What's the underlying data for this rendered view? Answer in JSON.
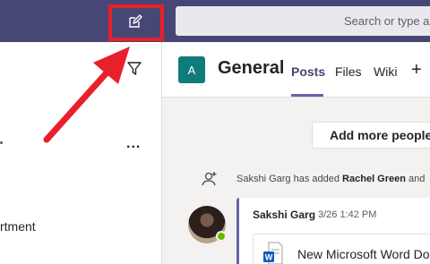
{
  "topbar": {
    "compose_icon": "compose-pencil-icon",
    "search_placeholder": "Search or type a"
  },
  "left_pane": {
    "filter_icon": "filter-icon",
    "more_options": "...",
    "dept_text": "rtment"
  },
  "channel": {
    "avatar_letter": "A",
    "name": "General",
    "tabs": [
      "Posts",
      "Files",
      "Wiki"
    ],
    "add_tab": "+"
  },
  "feed": {
    "add_people_label": "Add more people",
    "system_message": {
      "actor": "Sakshi Garg",
      "verb": "has added",
      "target": "Rachel Green",
      "tail": "and"
    },
    "post": {
      "author": "Sakshi Garg",
      "timestamp": "3/26 1:42 PM",
      "file_name": "New Microsoft Word Doc"
    }
  },
  "colors": {
    "topbar": "#464775",
    "accent": "#6264a7",
    "team_avatar": "#0f7b7b",
    "annotation": "#e8202b"
  }
}
